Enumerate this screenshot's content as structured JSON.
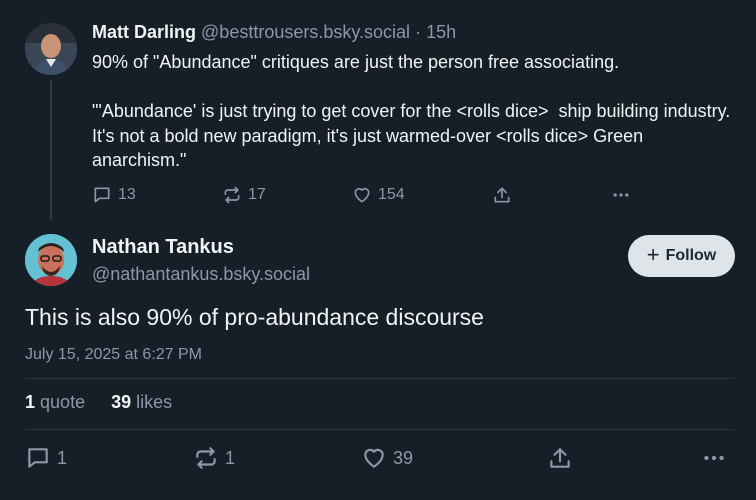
{
  "parent_post": {
    "author_name": "Matt Darling",
    "author_handle": "@besttrousers.bsky.social",
    "separator": "·",
    "time_ago": "15h",
    "body": "90% of \"Abundance\" critiques are just the person free associating.\n\n\"'Abundance' is just trying to get cover for the <rolls dice>  ship building industry. It's not a bold new paradigm, it's just warmed-over <rolls dice> Green anarchism.\"",
    "replies": "13",
    "reposts": "17",
    "likes": "154"
  },
  "main_post": {
    "author_name": "Nathan Tankus",
    "author_handle": "@nathantankus.bsky.social",
    "follow_label": "Follow",
    "follow_icon": "+",
    "text": "This is also 90% of pro-abundance discourse",
    "timestamp": "July 15, 2025 at 6:27 PM",
    "quote_count": "1",
    "quote_label": "quote",
    "like_count": "39",
    "like_label": "likes",
    "replies": "1",
    "reposts": "1",
    "likes": "39"
  },
  "colors": {
    "background": "#161e27",
    "text_primary": "#f1f3f5",
    "text_secondary": "#8b98a8",
    "follow_button_bg": "#dfe4e9"
  },
  "icons": [
    "reply-icon",
    "repost-icon",
    "like-icon",
    "share-icon",
    "more-icon",
    "plus-icon"
  ]
}
